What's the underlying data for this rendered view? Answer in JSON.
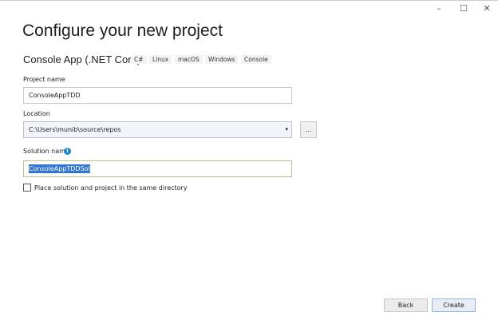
{
  "window": {
    "minimize": "–",
    "maximize": "☐",
    "close": "✕"
  },
  "title": "Configure your new project",
  "template": {
    "name": "Console App (.NET Core)",
    "tags": [
      "C#",
      "Linux",
      "macOS",
      "Windows",
      "Console"
    ]
  },
  "project_name": {
    "label": "Project name",
    "value": "ConsoleAppTDD"
  },
  "location": {
    "label": "Location",
    "value": "C:\\Users\\munib\\source\\repos",
    "browse": "..."
  },
  "solution_name": {
    "label": "Solution name",
    "value": "ConsoleAppTDDSol",
    "info_icon": "i"
  },
  "same_dir": {
    "label": "Place solution and project in the same directory",
    "checked": false
  },
  "footer": {
    "back": "Back",
    "create": "Create"
  }
}
